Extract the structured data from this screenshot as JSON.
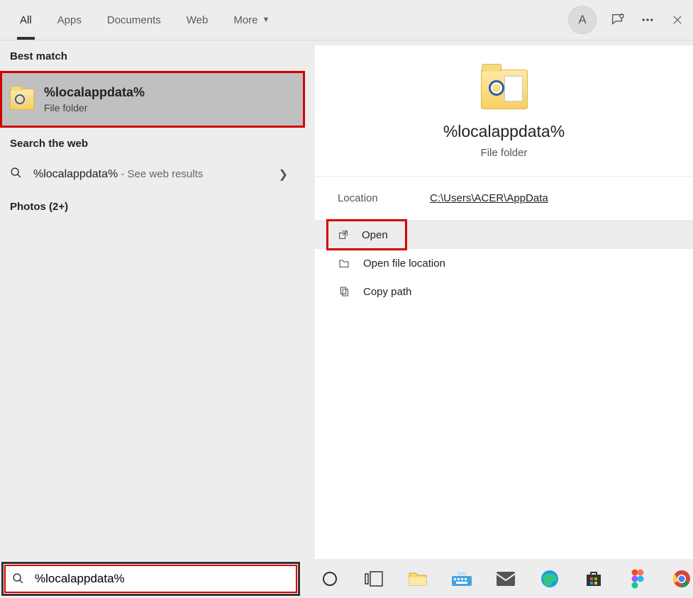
{
  "tabs": {
    "items": [
      {
        "label": "All",
        "active": true
      },
      {
        "label": "Apps",
        "active": false
      },
      {
        "label": "Documents",
        "active": false
      },
      {
        "label": "Web",
        "active": false
      },
      {
        "label": "More",
        "active": false,
        "dropdown": true
      }
    ]
  },
  "avatar_letter": "A",
  "left": {
    "best_match_header": "Best match",
    "best_match": {
      "title": "%localappdata%",
      "subtitle": "File folder"
    },
    "web_header": "Search the web",
    "web_item": {
      "query": "%localappdata%",
      "suffix": " - See web results"
    },
    "photos_header": "Photos (2+)"
  },
  "preview": {
    "title": "%localappdata%",
    "subtitle": "File folder",
    "location_label": "Location",
    "location_value": "C:\\Users\\ACER\\AppData",
    "actions": [
      {
        "label": "Open",
        "icon": "open"
      },
      {
        "label": "Open file location",
        "icon": "folder-open"
      },
      {
        "label": "Copy path",
        "icon": "copy"
      }
    ]
  },
  "search_value": "%localappdata%",
  "taskbar_apps": [
    "cortana",
    "task-view",
    "file-explorer",
    "keyboard",
    "mail",
    "edge",
    "microsoft-store",
    "figma",
    "chrome"
  ]
}
